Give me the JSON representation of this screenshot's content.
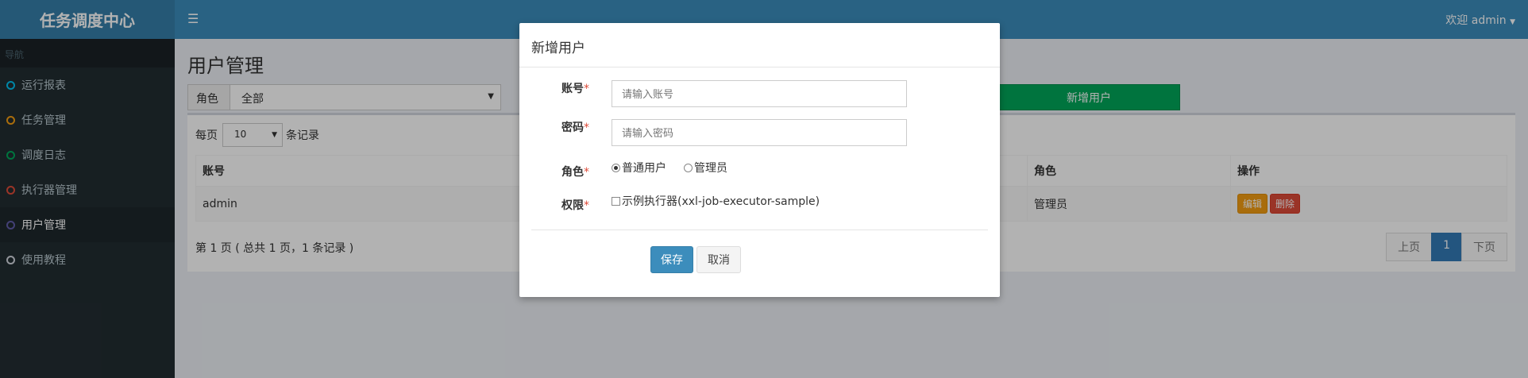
{
  "app": {
    "title": "任务调度中心",
    "user": "欢迎 admin"
  },
  "sidebar": {
    "header": "导航",
    "items": [
      {
        "label": "运行报表",
        "color": "#00c0ef"
      },
      {
        "label": "任务管理",
        "color": "#f39c12"
      },
      {
        "label": "调度日志",
        "color": "#00a65a"
      },
      {
        "label": "执行器管理",
        "color": "#dd4b39"
      },
      {
        "label": "用户管理",
        "color": "#605ca8",
        "active": true
      },
      {
        "label": "使用教程",
        "color": "#d2d6de"
      }
    ]
  },
  "page": {
    "title": "用户管理",
    "role_filter": {
      "label": "角色",
      "value": "全部"
    },
    "add_button": "新增用户",
    "per_page": {
      "prefix": "每页",
      "value": "10",
      "suffix": "条记录"
    },
    "table": {
      "headers": [
        "账号",
        "角色",
        "操作"
      ],
      "rows": [
        {
          "account": "admin",
          "role": "管理员",
          "edit": "编辑",
          "delete": "删除"
        }
      ]
    },
    "page_info": "第 1 页 ( 总共 1 页，1 条记录 )",
    "pager": {
      "prev": "上页",
      "current": "1",
      "next": "下页"
    }
  },
  "modal": {
    "title": "新增用户",
    "account": {
      "label": "账号",
      "placeholder": "请输入账号"
    },
    "password": {
      "label": "密码",
      "placeholder": "请输入密码"
    },
    "role": {
      "label": "角色",
      "options": [
        "普通用户",
        "管理员"
      ],
      "selected": "普通用户"
    },
    "permission": {
      "label": "权限",
      "options": [
        "示例执行器(xxl-job-executor-sample)"
      ]
    },
    "required_mark": "*",
    "save": "保存",
    "cancel": "取消"
  }
}
